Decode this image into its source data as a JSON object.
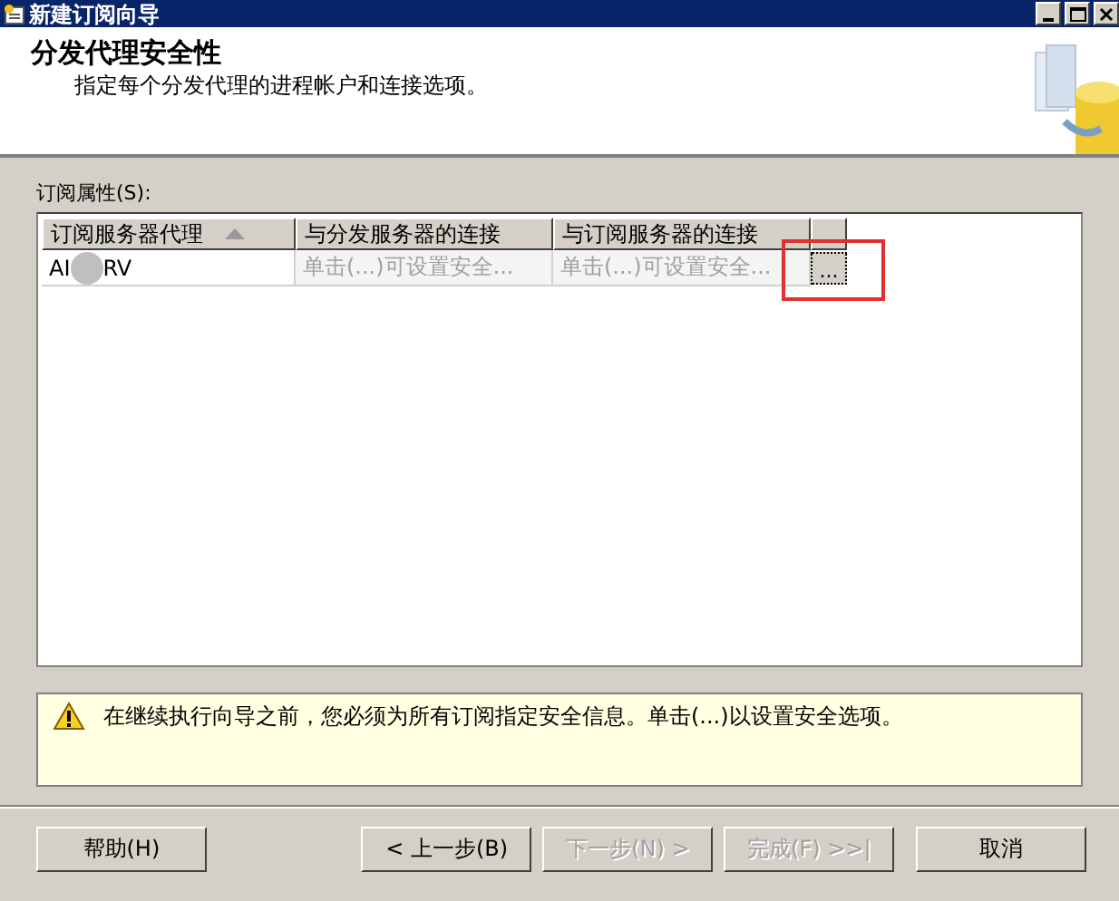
{
  "window": {
    "title": "新建订阅向导"
  },
  "header": {
    "title": "分发代理安全性",
    "subtitle": "指定每个分发代理的进程帐户和连接选项。"
  },
  "grid": {
    "label": "订阅属性(S):",
    "columns": [
      {
        "label": "订阅服务器代理",
        "sorted": true
      },
      {
        "label": "与分发服务器的连接",
        "sorted": false
      },
      {
        "label": "与订阅服务器的连接",
        "sorted": false
      }
    ],
    "rows": [
      {
        "agent_start": "AI",
        "agent_end": "RV",
        "distributor": "单击(...)可设置安全...",
        "subscriber": "单击(...)可设置安全...",
        "action": "...",
        "highlighted": true
      }
    ]
  },
  "message": {
    "text": "在继续执行向导之前，您必须为所有订阅指定安全信息。单击(...)以设置安全选项。"
  },
  "buttons": [
    {
      "label": "帮助(H)",
      "disabled": false
    },
    {
      "label": "< 上一步(B)",
      "disabled": false
    },
    {
      "label": "下一步(N) >",
      "disabled": true
    },
    {
      "label": "完成(F) >>|",
      "disabled": true
    },
    {
      "label": "取消",
      "disabled": false
    }
  ]
}
